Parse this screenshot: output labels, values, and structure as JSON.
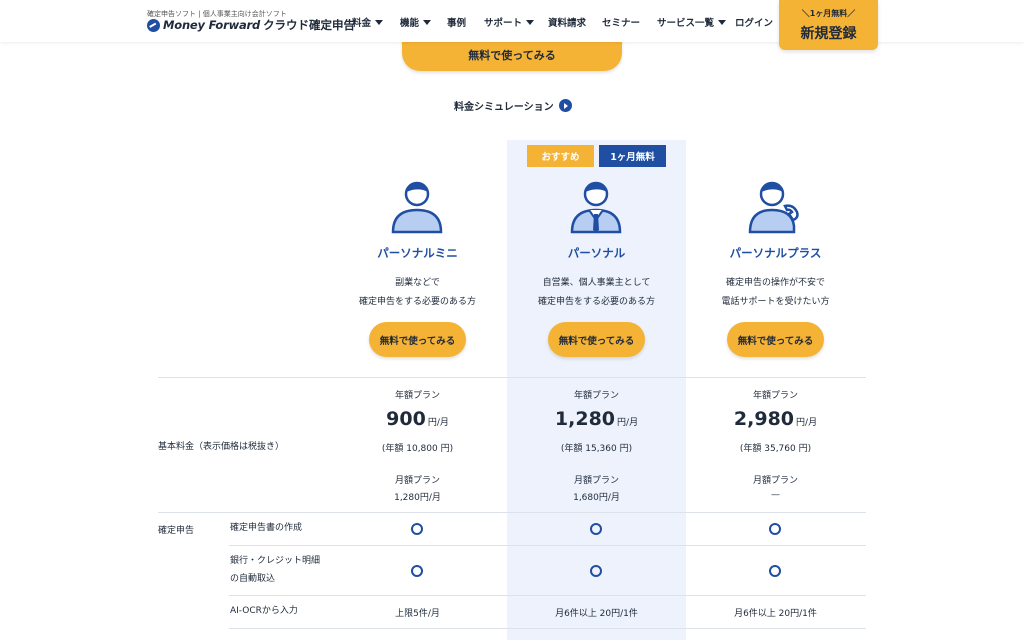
{
  "header": {
    "logo_sub": "確定申告ソフト | 個人事業主向け会計ソフト",
    "logo_brand": "Money Forward",
    "logo_product": "クラウド確定申告",
    "nav": [
      {
        "label": "料金",
        "dropdown": true
      },
      {
        "label": "機能",
        "dropdown": true
      },
      {
        "label": "事例",
        "dropdown": false
      },
      {
        "label": "サポート",
        "dropdown": true
      },
      {
        "label": "資料請求",
        "dropdown": false
      },
      {
        "label": "セミナー",
        "dropdown": false
      },
      {
        "label": "サービス一覧",
        "dropdown": true
      },
      {
        "label": "ログイン",
        "dropdown": false
      }
    ],
    "signup_small": "＼1ヶ月無料／",
    "signup_big": "新規登録"
  },
  "top_cta": "無料で使ってみる",
  "simulation_link": "料金シミュレーション",
  "badges": {
    "recommended": "おすすめ",
    "free_month": "1ヶ月無料"
  },
  "plans": [
    {
      "name": "パーソナルミニ",
      "desc": [
        "副業などで",
        "確定申告をする必要のある方"
      ],
      "cta": "無料で使ってみる",
      "annual_label": "年額プラン",
      "price": "900",
      "unit": "円/月",
      "annual_total": "(年額 10,800 円)",
      "monthly_label": "月額プラン",
      "monthly_price": "1,280円/月",
      "ocr": "上限5件/月"
    },
    {
      "name": "パーソナル",
      "desc": [
        "自営業、個人事業主として",
        "確定申告をする必要のある方"
      ],
      "cta": "無料で使ってみる",
      "annual_label": "年額プラン",
      "price": "1,280",
      "unit": "円/月",
      "annual_total": "(年額 15,360 円)",
      "monthly_label": "月額プラン",
      "monthly_price": "1,680円/月",
      "ocr": "月6件以上 20円/1件"
    },
    {
      "name": "パーソナルプラス",
      "desc": [
        "確定申告の操作が不安で",
        "電話サポートを受けたい方"
      ],
      "cta": "無料で使ってみる",
      "annual_label": "年額プラン",
      "price": "2,980",
      "unit": "円/月",
      "annual_total": "(年額 35,760 円)",
      "monthly_label": "月額プラン",
      "monthly_price": "—",
      "ocr": "月6件以上 20円/1件"
    }
  ],
  "table": {
    "base_fee_label": "基本料金（表示価格は税抜き）",
    "section_label": "確定申告",
    "features": [
      {
        "label": [
          "確定申告書の作成"
        ]
      },
      {
        "label": [
          "銀行・クレジット明細",
          "の自動取込"
        ]
      },
      {
        "label": [
          "AI-OCRから入力"
        ]
      }
    ]
  },
  "colors": {
    "accent": "#f5b335",
    "brand": "#1f4ea3",
    "highlight_bg": "#edf2fc"
  }
}
